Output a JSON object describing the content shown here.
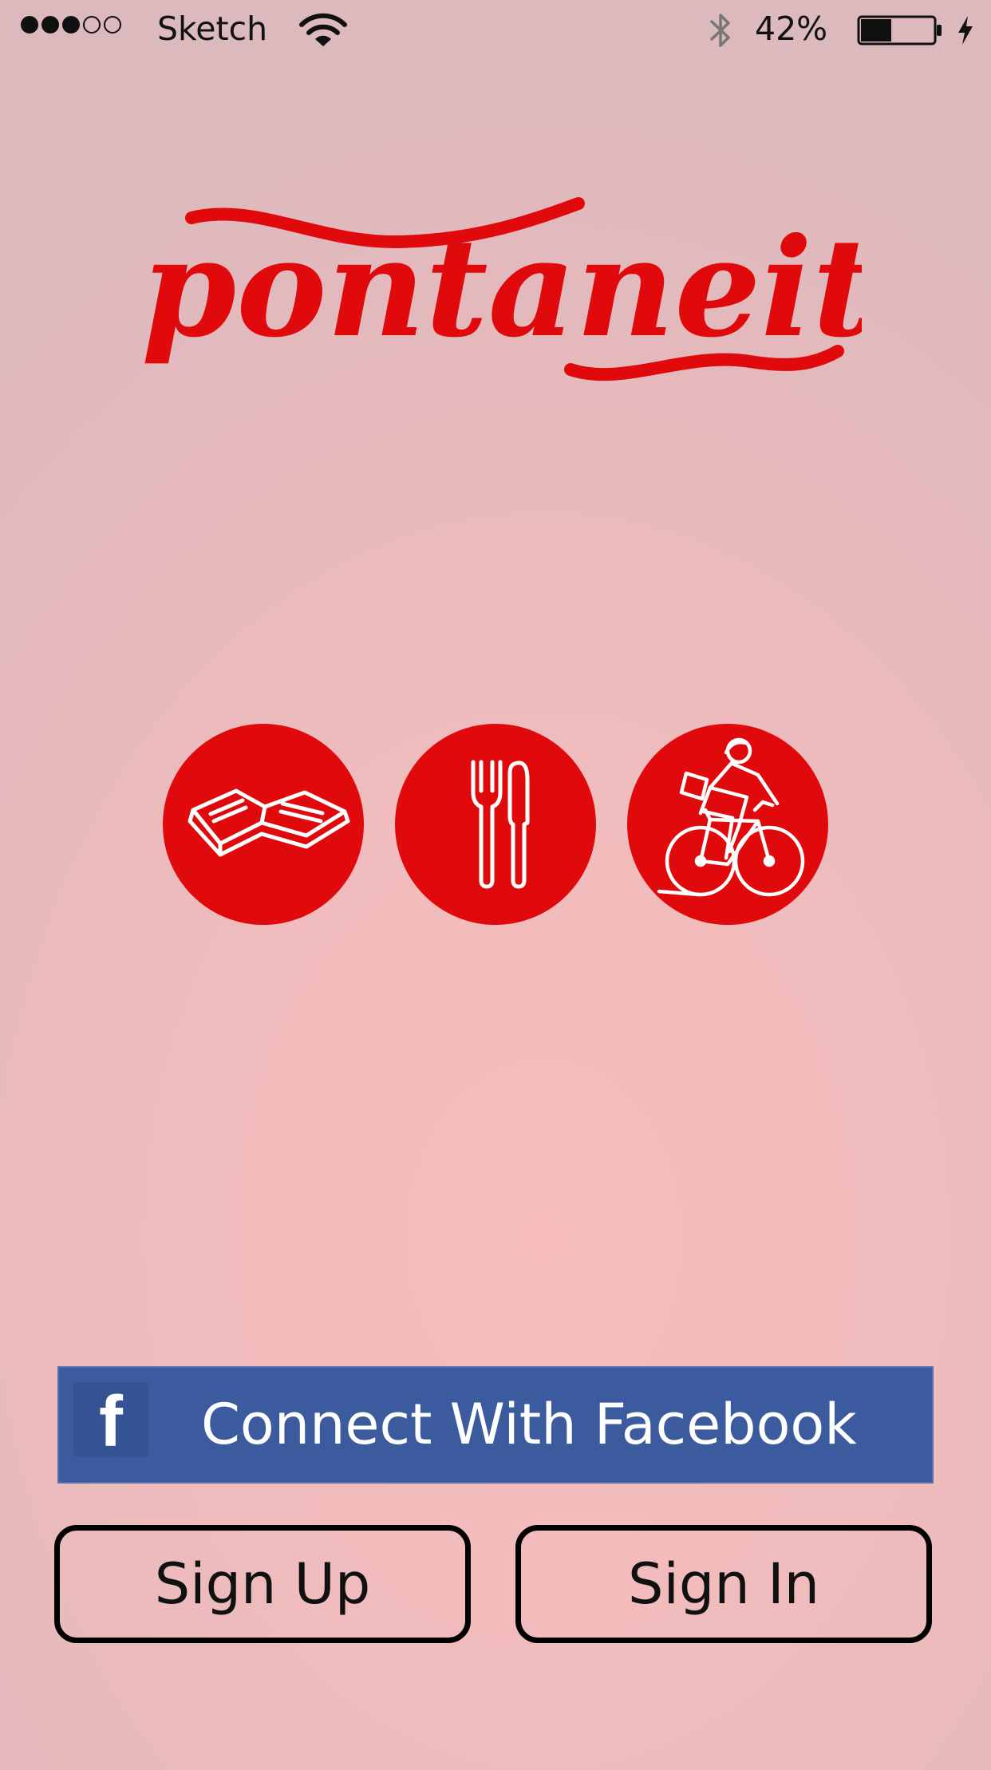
{
  "status_bar": {
    "carrier": "Sketch",
    "signal_bars_filled": 3,
    "signal_bars_total": 5,
    "battery_percent_label": "42%",
    "battery_level": 0.42,
    "icons": [
      "wifi-icon",
      "bluetooth-icon",
      "battery-icon",
      "charging-bolt-icon"
    ]
  },
  "app": {
    "logo_text": "Spontaneity",
    "brand_color": "#e00a0c"
  },
  "categories": [
    {
      "icon": "open-book-icon"
    },
    {
      "icon": "fork-knife-icon"
    },
    {
      "icon": "cyclist-icon"
    }
  ],
  "actions": {
    "facebook_label": "Connect With Facebook",
    "facebook_icon": "facebook-f-icon",
    "facebook_color": "#3c5a9e",
    "signup_label": "Sign Up",
    "signin_label": "Sign In"
  }
}
